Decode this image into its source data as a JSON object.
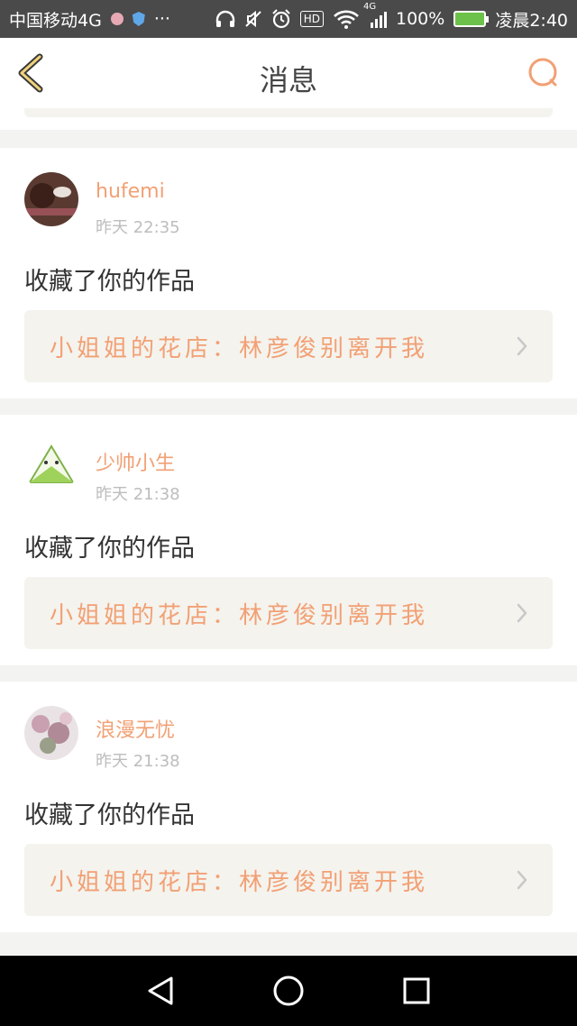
{
  "status_bar": {
    "carrier": "中国移动4G",
    "more": "···",
    "signal_label": "4G",
    "hd": "HD",
    "battery_pct": "100%",
    "time": "凌晨2:40",
    "colors": {
      "bg": "#4a4a4a",
      "battery": "#6cc14b"
    }
  },
  "header": {
    "title": "消息",
    "back_icon": "chevron-left-icon",
    "search_icon": "search-icon",
    "accent": "#f2a074"
  },
  "notifications": [
    {
      "username": "hufemi",
      "time": "昨天 22:35",
      "action": "收藏了你的作品",
      "work_title": "小姐姐的花店：林彦俊别离开我",
      "avatar_icon": "avatar-dark-photo"
    },
    {
      "username": "少帅小生",
      "time": "昨天 21:38",
      "action": "收藏了你的作品",
      "work_title": "小姐姐的花店：林彦俊别离开我",
      "avatar_icon": "avatar-rice-dumpling"
    },
    {
      "username": "浪漫无忧",
      "time": "昨天 21:38",
      "action": "收藏了你的作品",
      "work_title": "小姐姐的花店：林彦俊别离开我",
      "avatar_icon": "avatar-blossom-photo"
    }
  ],
  "nav_bar": {
    "back": "triangle-back-icon",
    "home": "circle-home-icon",
    "recent": "square-recent-icon"
  }
}
